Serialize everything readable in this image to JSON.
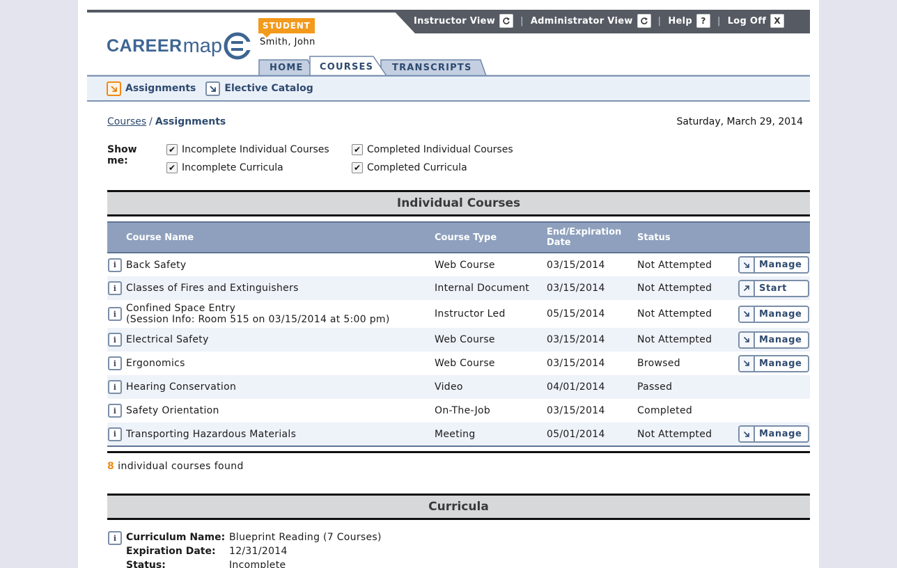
{
  "header": {
    "logo_part1": "CAREER",
    "logo_part2": "map",
    "role_badge": "STUDENT",
    "user_name": "Smith, John"
  },
  "topbar": {
    "instructor_view": "Instructor View",
    "administrator_view": "Administrator View",
    "help": "Help",
    "help_icon_glyph": "?",
    "log_off": "Log Off",
    "log_off_icon_glyph": "X",
    "separator": "|"
  },
  "tabs": [
    {
      "label": "HOME",
      "active": false
    },
    {
      "label": "COURSES",
      "active": true
    },
    {
      "label": "TRANSCRIPTS",
      "active": false
    }
  ],
  "subnav": {
    "assignments": "Assignments",
    "elective_catalog": "Elective Catalog"
  },
  "breadcrumb": {
    "parent": "Courses",
    "separator": "/",
    "current": "Assignments"
  },
  "date": "Saturday, March 29, 2014",
  "filters": {
    "label": "Show me:",
    "incomplete_individual": "Incomplete Individual Courses",
    "completed_individual": "Completed Individual Courses",
    "incomplete_curricula": "Incomplete Curricula",
    "completed_curricula": "Completed Curricula"
  },
  "individual_courses": {
    "section_title": "Individual Courses",
    "columns": {
      "name": "Course Name",
      "type": "Course Type",
      "date": "End/Expiration Date",
      "status": "Status"
    },
    "rows": [
      {
        "name": "Back Safety",
        "type": "Web Course",
        "date": "03/15/2014",
        "status": "Not Attempted",
        "action": "Manage"
      },
      {
        "name": "Classes of Fires and Extinguishers",
        "type": "Internal Document",
        "date": "03/15/2014",
        "status": "Not Attempted",
        "action": "Start"
      },
      {
        "name": "Confined Space Entry",
        "session": "(Session Info: Room 515 on 03/15/2014 at 5:00 pm)",
        "type": "Instructor Led",
        "date": "05/15/2014",
        "status": "Not Attempted",
        "action": "Manage"
      },
      {
        "name": "Electrical Safety",
        "type": "Web Course",
        "date": "03/15/2014",
        "status": "Not Attempted",
        "action": "Manage"
      },
      {
        "name": "Ergonomics",
        "type": "Web Course",
        "date": "03/15/2014",
        "status": "Browsed",
        "action": "Manage"
      },
      {
        "name": "Hearing Conservation",
        "type": "Video",
        "date": "04/01/2014",
        "status": "Passed",
        "action": ""
      },
      {
        "name": "Safety Orientation",
        "type": "On-The-Job",
        "date": "03/15/2014",
        "status": "Completed",
        "action": ""
      },
      {
        "name": "Transporting Hazardous Materials",
        "type": "Meeting",
        "date": "05/01/2014",
        "status": "Not Attempted",
        "action": "Manage"
      }
    ],
    "count_number": "8",
    "count_text": "individual courses found"
  },
  "curricula": {
    "section_title": "Curricula",
    "name_label": "Curriculum Name:",
    "name_value": "Blueprint Reading (7 Courses)",
    "expiration_label": "Expiration Date:",
    "expiration_value": "12/31/2014",
    "status_label": "Status:",
    "status_value": "Incomplete"
  },
  "colors": {
    "brand_blue": "#3d6592",
    "accent_orange": "#f39a1d",
    "header_dark": "#555a63",
    "table_header": "#8ea0bd"
  },
  "icons": {
    "info": "info-icon",
    "manage": "arrow-down-right-icon",
    "start": "arrow-up-right-icon",
    "refresh": "refresh-icon",
    "check": "checkmark-icon"
  }
}
